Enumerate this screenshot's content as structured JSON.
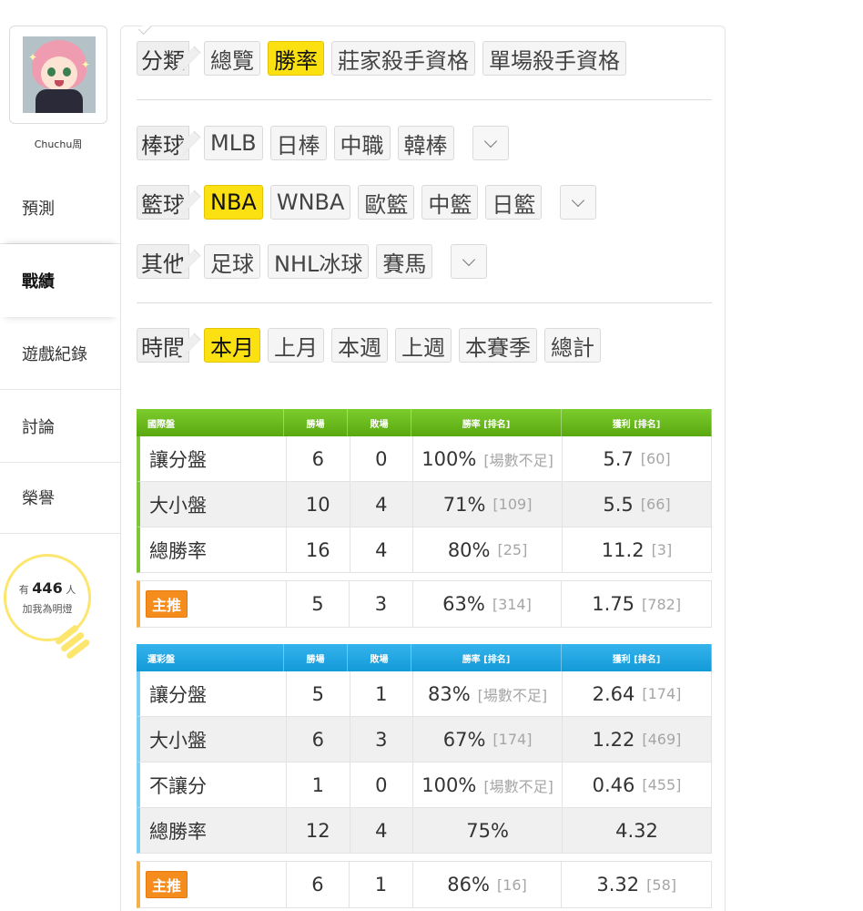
{
  "sidebar": {
    "username": "Chuchu周",
    "nav": [
      {
        "label": "預測"
      },
      {
        "label": "戰績"
      },
      {
        "label": "遊戲紀錄"
      },
      {
        "label": "討論"
      },
      {
        "label": "榮譽"
      }
    ],
    "bulb": {
      "prefix": "有",
      "count": "446",
      "suffix": "人",
      "text": "加我為明燈"
    }
  },
  "filters": {
    "category": {
      "label": "分類",
      "items": [
        "總覽",
        "勝率",
        "莊家殺手資格",
        "單場殺手資格"
      ],
      "active": "勝率"
    },
    "baseball": {
      "label": "棒球",
      "items": [
        "MLB",
        "日棒",
        "中職",
        "韓棒"
      ]
    },
    "basketball": {
      "label": "籃球",
      "items": [
        "NBA",
        "WNBA",
        "歐籃",
        "中籃",
        "日籃"
      ],
      "active": "NBA"
    },
    "other": {
      "label": "其他",
      "items": [
        "足球",
        "NHL冰球",
        "賽馬"
      ]
    },
    "time": {
      "label": "時間",
      "items": [
        "本月",
        "上月",
        "本週",
        "上週",
        "本賽季",
        "總計"
      ],
      "active": "本月"
    }
  },
  "international": {
    "headers": [
      "國際盤",
      "勝場",
      "敗場",
      "勝率 [排名]",
      "獲利 [排名]"
    ],
    "rows": [
      {
        "name": "讓分盤",
        "win": "6",
        "loss": "0",
        "rate": "100%",
        "rate_rank": "[場數不足]",
        "profit": "5.7",
        "profit_rank": "[60]"
      },
      {
        "name": "大小盤",
        "win": "10",
        "loss": "4",
        "rate": "71%",
        "rate_rank": "[109]",
        "profit": "5.5",
        "profit_rank": "[66]"
      },
      {
        "name": "總勝率",
        "win": "16",
        "loss": "4",
        "rate": "80%",
        "rate_rank": "[25]",
        "profit": "11.2",
        "profit_rank": "[3]"
      }
    ],
    "recommend": {
      "badge": "主推",
      "win": "5",
      "loss": "3",
      "rate": "63%",
      "rate_rank": "[314]",
      "profit": "1.75",
      "profit_rank": "[782]"
    }
  },
  "lottery": {
    "headers": [
      "運彩盤",
      "勝場",
      "敗場",
      "勝率 [排名]",
      "獲利 [排名]"
    ],
    "rows": [
      {
        "name": "讓分盤",
        "win": "5",
        "loss": "1",
        "rate": "83%",
        "rate_rank": "[場數不足]",
        "profit": "2.64",
        "profit_rank": "[174]"
      },
      {
        "name": "大小盤",
        "win": "6",
        "loss": "3",
        "rate": "67%",
        "rate_rank": "[174]",
        "profit": "1.22",
        "profit_rank": "[469]"
      },
      {
        "name": "不讓分",
        "win": "1",
        "loss": "0",
        "rate": "100%",
        "rate_rank": "[場數不足]",
        "profit": "0.46",
        "profit_rank": "[455]"
      },
      {
        "name": "總勝率",
        "win": "12",
        "loss": "4",
        "rate": "75%",
        "rate_rank": "",
        "profit": "4.32",
        "profit_rank": ""
      }
    ],
    "recommend": {
      "badge": "主推",
      "win": "6",
      "loss": "1",
      "rate": "86%",
      "rate_rank": "[16]",
      "profit": "3.32",
      "profit_rank": "[58]"
    }
  },
  "colors": {
    "accent_yellow": "#fbe012",
    "green_header": "#5aa80f",
    "blue_header": "#129ad8",
    "orange_badge": "#f58d1e"
  }
}
